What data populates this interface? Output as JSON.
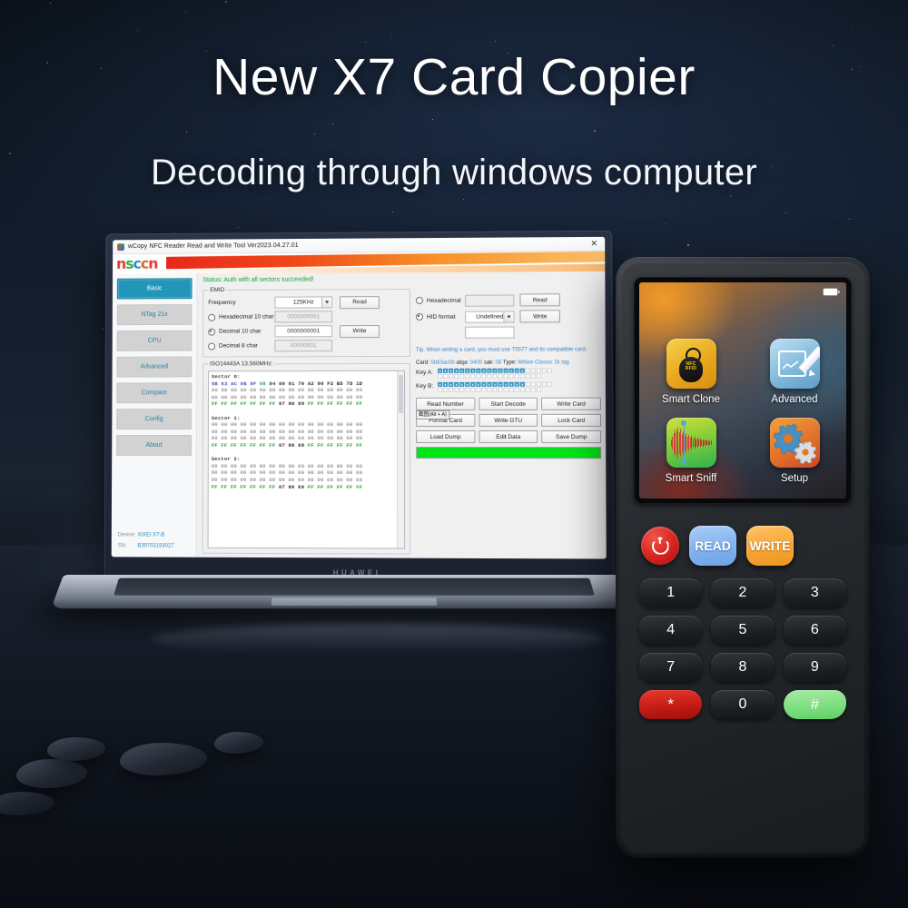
{
  "hero": {
    "headline": "New X7 Card Copier",
    "subhead": "Decoding through windows computer"
  },
  "laptop": {
    "brand": "HUAWEI"
  },
  "app": {
    "title": "wCopy NFC Reader Read and Write Tool  Ver2023.04.27.01",
    "close_label": "✕",
    "logo_letters": [
      "n",
      "s",
      "c",
      "c",
      "n"
    ],
    "status": "Status: Auth with all sectors succeeded!",
    "sidebar": {
      "items": [
        {
          "label": "Basic",
          "active": true
        },
        {
          "label": "NTag 21x",
          "active": false
        },
        {
          "label": "CPU",
          "active": false
        },
        {
          "label": "Advanced",
          "active": false
        },
        {
          "label": "Compare",
          "active": false
        },
        {
          "label": "Config",
          "active": false
        },
        {
          "label": "About",
          "active": false
        }
      ],
      "device_label": "Device:",
      "device_value": "XIXEI X7-B",
      "sn_label": "SN:",
      "sn_value": "B39703193027"
    },
    "emid": {
      "legend": "EMID",
      "frequency_label": "Frequency",
      "frequency_value": "125KHz",
      "read_label": "Read",
      "write_label": "Write",
      "hex10_label": "Hexadecimal 10 char",
      "hex10_value": "0000000001",
      "hex10_selected": false,
      "dec10_label": "Decimal 10 char",
      "dec10_value": "0000000001",
      "dec10_selected": true,
      "dec8_label": "Decimal 8 char",
      "dec8_value": "00000001",
      "dec8_selected": false
    },
    "right_panel": {
      "hexadecimal_label": "Hexadecimal",
      "hexadecimal_value": "",
      "hexadecimal_selected": false,
      "hid_label": "HID format",
      "hid_selected": true,
      "hid_dropdown_value": "Undefined",
      "hid_extra_value": "",
      "read_label": "Read",
      "write_label": "Write",
      "tip": "Tip: When writing a card, you must use T5577 and its compatible card."
    },
    "iso": {
      "legend": "ISO14443A 13.560MHz:",
      "sectors": [
        {
          "title": "Sector 0:",
          "rows": [
            {
              "type": "uid",
              "bytes": [
                "5B",
                "63",
                "AC",
                "0B",
                "9F",
                "08",
                "04",
                "00",
                "01",
                "70",
                "A2",
                "90",
                "F2",
                "B5",
                "7D",
                "1D"
              ]
            },
            {
              "type": "zero",
              "bytes": [
                "00",
                "00",
                "00",
                "00",
                "00",
                "00",
                "00",
                "00",
                "00",
                "00",
                "00",
                "00",
                "00",
                "00",
                "00",
                "00"
              ]
            },
            {
              "type": "zero",
              "bytes": [
                "00",
                "00",
                "00",
                "00",
                "00",
                "00",
                "00",
                "00",
                "00",
                "00",
                "00",
                "00",
                "00",
                "00",
                "00",
                "00"
              ]
            },
            {
              "type": "key",
              "bytes": [
                "FF",
                "FF",
                "FF",
                "FF",
                "FF",
                "FF",
                "FF",
                "07",
                "80",
                "69",
                "FF",
                "FF",
                "FF",
                "FF",
                "FF",
                "FF"
              ]
            }
          ]
        },
        {
          "title": "Sector 1:",
          "rows": [
            {
              "type": "zero",
              "bytes": [
                "00",
                "00",
                "00",
                "00",
                "00",
                "00",
                "00",
                "00",
                "00",
                "00",
                "00",
                "00",
                "00",
                "00",
                "00",
                "00"
              ]
            },
            {
              "type": "zero",
              "bytes": [
                "00",
                "00",
                "00",
                "00",
                "00",
                "00",
                "00",
                "00",
                "00",
                "00",
                "00",
                "00",
                "00",
                "00",
                "00",
                "00"
              ]
            },
            {
              "type": "zero",
              "bytes": [
                "00",
                "00",
                "00",
                "00",
                "00",
                "00",
                "00",
                "00",
                "00",
                "00",
                "00",
                "00",
                "00",
                "00",
                "00",
                "00"
              ]
            },
            {
              "type": "key",
              "bytes": [
                "FF",
                "FF",
                "FF",
                "FF",
                "FF",
                "FF",
                "FF",
                "07",
                "80",
                "69",
                "FF",
                "FF",
                "FF",
                "FF",
                "FF",
                "FF"
              ]
            }
          ]
        },
        {
          "title": "Sector 2:",
          "rows": [
            {
              "type": "zero",
              "bytes": [
                "00",
                "00",
                "00",
                "00",
                "00",
                "00",
                "00",
                "00",
                "00",
                "00",
                "00",
                "00",
                "00",
                "00",
                "00",
                "00"
              ]
            },
            {
              "type": "zero",
              "bytes": [
                "00",
                "00",
                "00",
                "00",
                "00",
                "00",
                "00",
                "00",
                "00",
                "00",
                "00",
                "00",
                "00",
                "00",
                "00",
                "00"
              ]
            },
            {
              "type": "zero",
              "bytes": [
                "00",
                "00",
                "00",
                "00",
                "00",
                "00",
                "00",
                "00",
                "00",
                "00",
                "00",
                "00",
                "00",
                "00",
                "00",
                "00"
              ]
            },
            {
              "type": "key",
              "bytes": [
                "FF",
                "FF",
                "FF",
                "FF",
                "FF",
                "FF",
                "FF",
                "07",
                "80",
                "69",
                "FF",
                "FF",
                "FF",
                "FF",
                "FF",
                "FF"
              ]
            }
          ]
        }
      ]
    },
    "card": {
      "card_label": "Card:",
      "uid": "5b63ac0b",
      "atqa_label": "atqa:",
      "atqa": "0400",
      "sak_label": "sak:",
      "sak": "08",
      "type_label": "Type:",
      "type": "Mifare Classic 1k tag",
      "key_a_label": "Key A:",
      "key_b_label": "Key B:",
      "key_cells_filled": 16,
      "key_cells_total": 20
    },
    "action_buttons": [
      "Read Number",
      "Start Decode",
      "Write Card",
      "Format Card",
      "Write GTU",
      "Lock Card",
      "Load Dump",
      "Edit Data",
      "Save Dump"
    ],
    "tooltip": "截图(Alt + A)",
    "progress_color": "#00e515"
  },
  "device": {
    "apps": [
      {
        "label": "Smart Clone",
        "icon": "nfc-keyfob-icon",
        "badge_line1": "NFC",
        "badge_line2": "RFID"
      },
      {
        "label": "Advanced",
        "icon": "edit-pencil-icon"
      },
      {
        "label": "Smart Sniff",
        "icon": "waveform-icon"
      },
      {
        "label": "Setup",
        "icon": "gears-icon"
      }
    ],
    "keys": {
      "power": "power-icon",
      "read": "READ",
      "write": "WRITE",
      "numbers": [
        "1",
        "2",
        "3",
        "4",
        "5",
        "6",
        "7",
        "8",
        "9"
      ],
      "star": "*",
      "zero": "0",
      "hash": "#"
    }
  }
}
